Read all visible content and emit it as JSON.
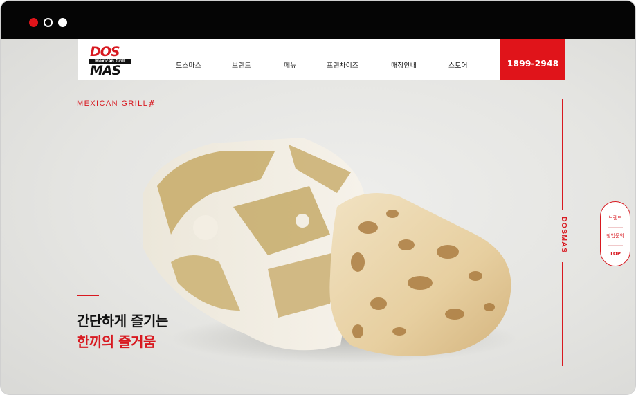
{
  "window": {
    "controls": [
      "close",
      "minimize",
      "maximize"
    ]
  },
  "brand": {
    "logo_top": "DOS",
    "logo_bar": "Mexican Grill",
    "logo_bottom": "MAS"
  },
  "nav": {
    "items": [
      "도스마스",
      "브랜드",
      "메뉴",
      "프랜차이즈",
      "매장안내",
      "스토어"
    ],
    "phone": "1899-2948"
  },
  "hero": {
    "tagline": "MEXICAN GRILL",
    "tagline_mark": "#",
    "headline_line1": "간단하게 즐기는",
    "headline_line2": "한끼의 즐거움",
    "vertical_label": "DOSMAS"
  },
  "quick_menu": {
    "items": [
      "브랜드",
      "창업문의",
      "TOP"
    ]
  },
  "colors": {
    "accent": "#e0141a",
    "titlebar": "#050505",
    "background": "#e6e6e4"
  }
}
